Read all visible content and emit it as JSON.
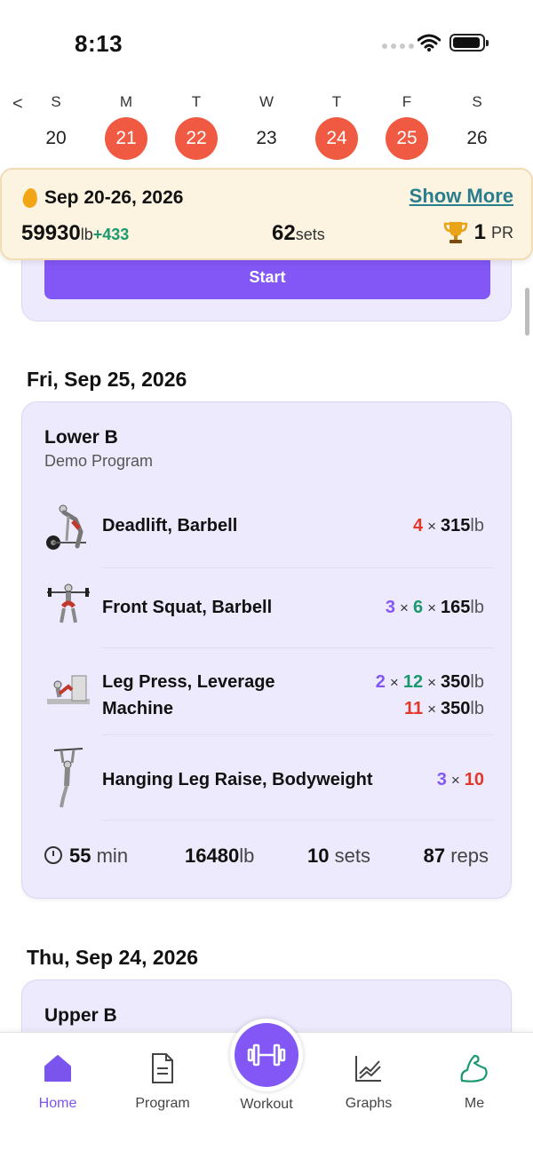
{
  "status": {
    "time": "8:13"
  },
  "week": {
    "days": [
      {
        "letter": "S",
        "num": "20",
        "active": false
      },
      {
        "letter": "M",
        "num": "21",
        "active": true
      },
      {
        "letter": "T",
        "num": "22",
        "active": true
      },
      {
        "letter": "W",
        "num": "23",
        "active": false
      },
      {
        "letter": "T",
        "num": "24",
        "active": true
      },
      {
        "letter": "F",
        "num": "25",
        "active": true
      },
      {
        "letter": "S",
        "num": "26",
        "active": false
      }
    ],
    "prev": "<"
  },
  "summary": {
    "range": "Sep 20-26, 2026",
    "show_more": "Show More",
    "volume": "59930",
    "volume_unit": "lb",
    "volume_delta": "+433",
    "sets": "62",
    "sets_unit": "sets",
    "pr": "1",
    "pr_unit": "PR"
  },
  "partial_card": {
    "start_label": "Start"
  },
  "day_fri": {
    "date": "Fri, Sep 25, 2026",
    "workout_name": "Lower B",
    "program": "Demo Program",
    "exercises": [
      {
        "name": "Deadlift, Barbell",
        "sets": "4",
        "weight": "315",
        "unit": "lb"
      },
      {
        "name": "Front Squat, Barbell",
        "sets": "3",
        "reps": "6",
        "weight": "165",
        "unit": "lb"
      },
      {
        "name_1": "Leg Press, Leverage",
        "name_2": "Machine",
        "sets": "2",
        "reps": "12",
        "weight": "350",
        "unit": "lb",
        "sets_b": "11",
        "weight_b": "350",
        "unit_b": "lb"
      },
      {
        "name": "Hanging Leg Raise, Bodyweight",
        "sets": "3",
        "reps": "10"
      }
    ],
    "stats": {
      "duration": "55",
      "duration_unit": "min",
      "volume": "16480",
      "volume_unit": "lb",
      "sets": "10",
      "sets_unit": "sets",
      "reps": "87",
      "reps_unit": "reps"
    }
  },
  "day_thu": {
    "date": "Thu, Sep 24, 2026",
    "workout_name": "Upper B"
  },
  "nav": {
    "home": "Home",
    "program": "Program",
    "workout": "Workout",
    "graphs": "Graphs",
    "me": "Me"
  },
  "colors": {
    "accent": "#8257f5",
    "active_day": "#f05a43",
    "banner": "#fdf3e1",
    "card": "#eeeafd"
  }
}
